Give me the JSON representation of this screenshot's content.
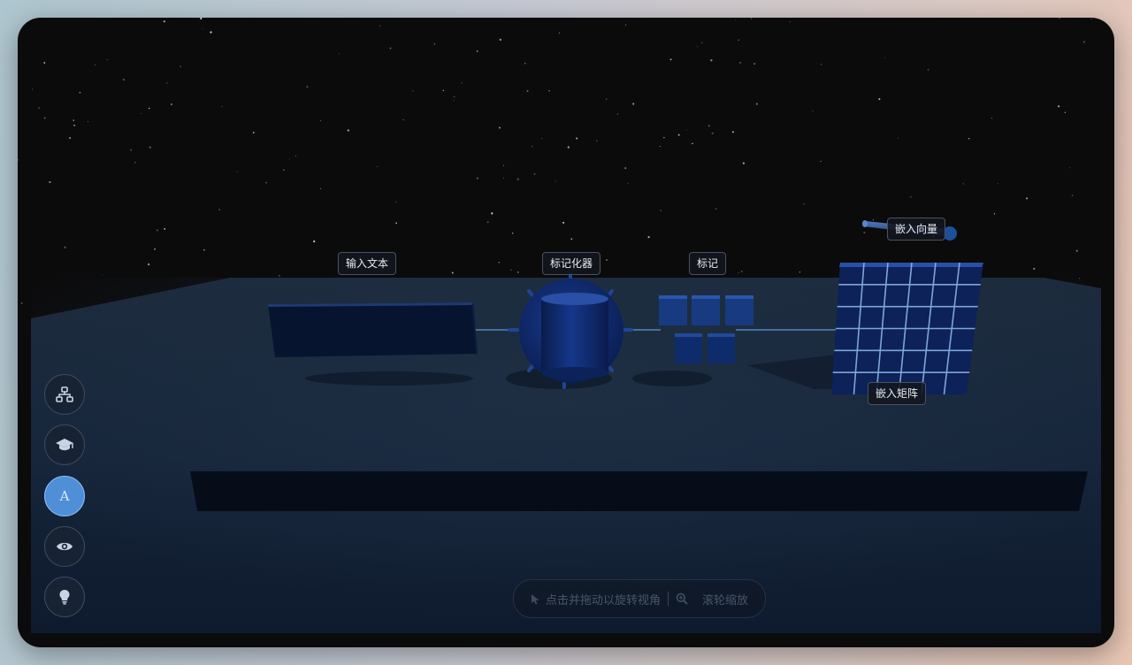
{
  "scene": {
    "labels": {
      "input_text": "输入文本",
      "tokenizer": "标记化器",
      "tokens": "标记",
      "embedding_vector": "嵌入向量",
      "embedding_matrix": "嵌入矩阵"
    }
  },
  "toolbar": {
    "buttons": [
      {
        "icon": "network-icon"
      },
      {
        "icon": "graduation-cap-icon"
      },
      {
        "icon": "font-icon",
        "label": "A",
        "active": true
      },
      {
        "icon": "eye-icon"
      },
      {
        "icon": "lightbulb-icon"
      }
    ]
  },
  "hint": {
    "rotate": "点击并拖动以旋转视角",
    "zoom": "滚轮缩放"
  },
  "colors": {
    "accent": "#4f8fd8",
    "object_blue": "#0e2a6b",
    "grid_line": "#8cb4e8"
  }
}
